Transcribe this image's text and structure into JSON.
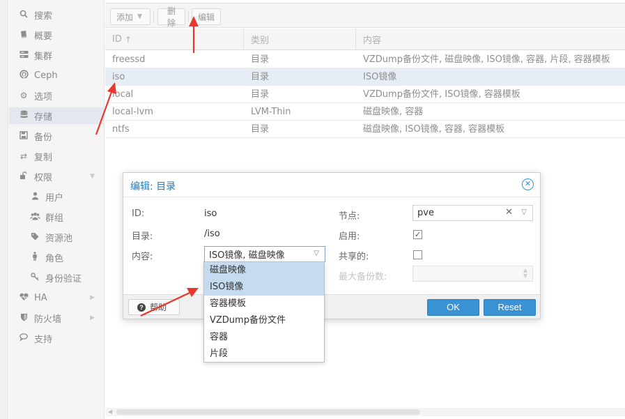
{
  "sidebar": {
    "items": [
      {
        "label": "搜索",
        "icon": "search-icon"
      },
      {
        "label": "概要",
        "icon": "book-icon"
      },
      {
        "label": "集群",
        "icon": "server-icon"
      },
      {
        "label": "Ceph",
        "icon": "ceph-icon"
      },
      {
        "label": "选项",
        "icon": "gear-icon"
      },
      {
        "label": "存储",
        "icon": "database-icon"
      },
      {
        "label": "备份",
        "icon": "floppy-icon"
      },
      {
        "label": "复制",
        "icon": "retweet-icon"
      },
      {
        "label": "权限",
        "icon": "unlock-icon"
      },
      {
        "label": "用户",
        "icon": "user-icon"
      },
      {
        "label": "群组",
        "icon": "users-icon"
      },
      {
        "label": "资源池",
        "icon": "tags-icon"
      },
      {
        "label": "角色",
        "icon": "male-icon"
      },
      {
        "label": "身份验证",
        "icon": "key-icon"
      },
      {
        "label": "HA",
        "icon": "heartbeat-icon"
      },
      {
        "label": "防火墙",
        "icon": "shield-icon"
      },
      {
        "label": "支持",
        "icon": "comments-icon"
      }
    ]
  },
  "toolbar": {
    "add_label": "添加",
    "delete_label": "删除",
    "edit_label": "编辑"
  },
  "grid": {
    "columns": [
      "ID",
      "类别",
      "内容"
    ],
    "sort_indicator": "↑",
    "rows": [
      {
        "id": "freessd",
        "type": "目录",
        "content": "VZDump备份文件, 磁盘映像, ISO镜像, 容器, 片段, 容器模板"
      },
      {
        "id": "iso",
        "type": "目录",
        "content": "ISO镜像"
      },
      {
        "id": "local",
        "type": "目录",
        "content": "VZDump备份文件, ISO镜像, 容器模板"
      },
      {
        "id": "local-lvm",
        "type": "LVM-Thin",
        "content": "磁盘映像, 容器"
      },
      {
        "id": "ntfs",
        "type": "目录",
        "content": "磁盘映像, ISO镜像, 容器, 容器模板"
      }
    ]
  },
  "dialog": {
    "title": "编辑: 目录",
    "id_label": "ID:",
    "id_value": "iso",
    "dir_label": "目录:",
    "dir_value": "/iso",
    "content_label": "内容:",
    "content_value": "ISO镜像, 磁盘映像",
    "node_label": "节点:",
    "node_value": "pve",
    "enable_label": "启用:",
    "shared_label": "共享的:",
    "maxbackup_label": "最大备份数:",
    "help_label": "帮助",
    "ok_label": "OK",
    "reset_label": "Reset"
  },
  "dropdown": {
    "options": [
      "磁盘映像",
      "ISO镜像",
      "容器模板",
      "VZDump备份文件",
      "容器",
      "片段"
    ]
  },
  "colors": {
    "accent": "#3892d3",
    "selected_row": "#e6edf5",
    "dropdown_selected": "#c4dbf0",
    "annotation_arrow": "#e8382f"
  }
}
